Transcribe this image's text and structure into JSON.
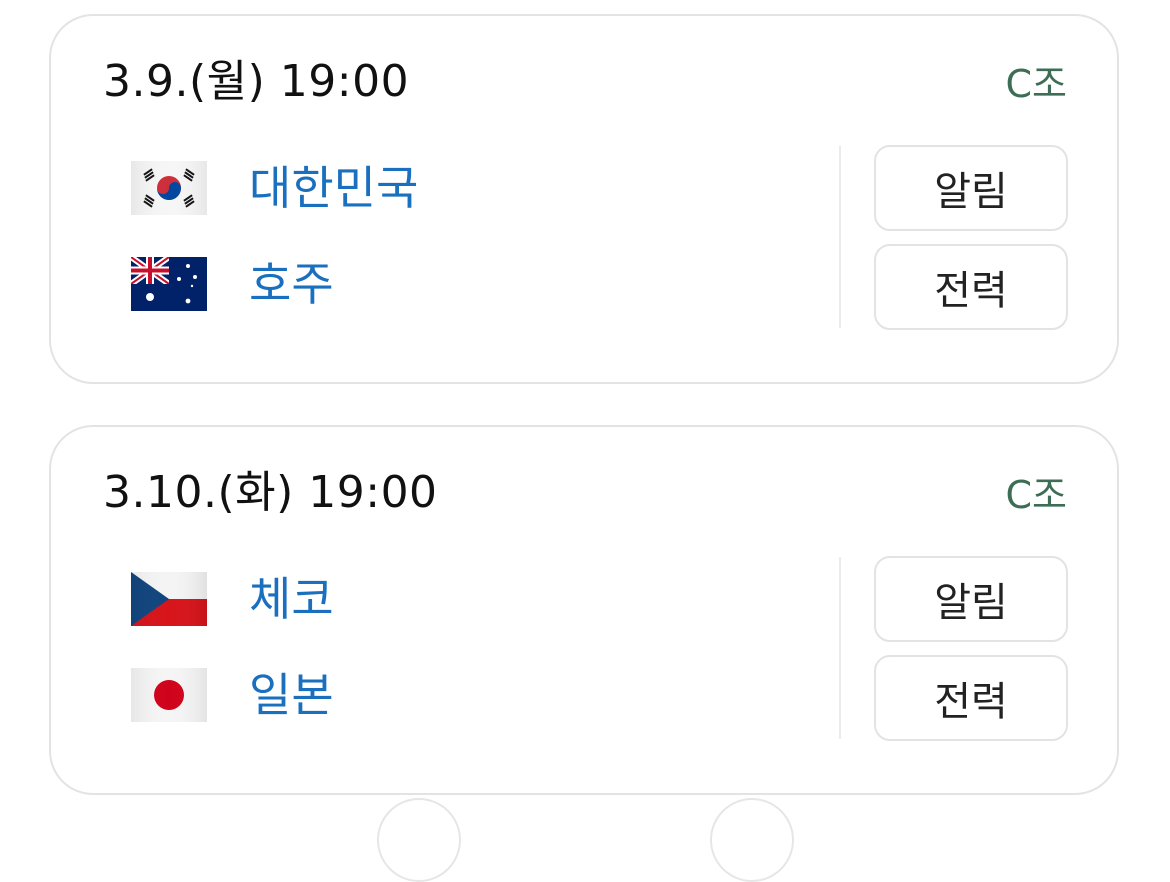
{
  "matches": [
    {
      "time": "3.9.(월) 19:00",
      "group": "C조",
      "teams": [
        {
          "name": "대한민국",
          "flag_icon": "south-korea-flag-icon"
        },
        {
          "name": "호주",
          "flag_icon": "australia-flag-icon"
        }
      ],
      "buttons": {
        "alert_label": "알림",
        "lineup_label": "전력"
      }
    },
    {
      "time": "3.10.(화) 19:00",
      "group": "C조",
      "teams": [
        {
          "name": "체코",
          "flag_icon": "czech-flag-icon"
        },
        {
          "name": "일본",
          "flag_icon": "japan-flag-icon"
        }
      ],
      "buttons": {
        "alert_label": "알림",
        "lineup_label": "전력"
      }
    }
  ],
  "colors": {
    "team_link": "#1a6fbf",
    "group_label": "#3d6e55",
    "card_border": "#e3e3e3"
  }
}
